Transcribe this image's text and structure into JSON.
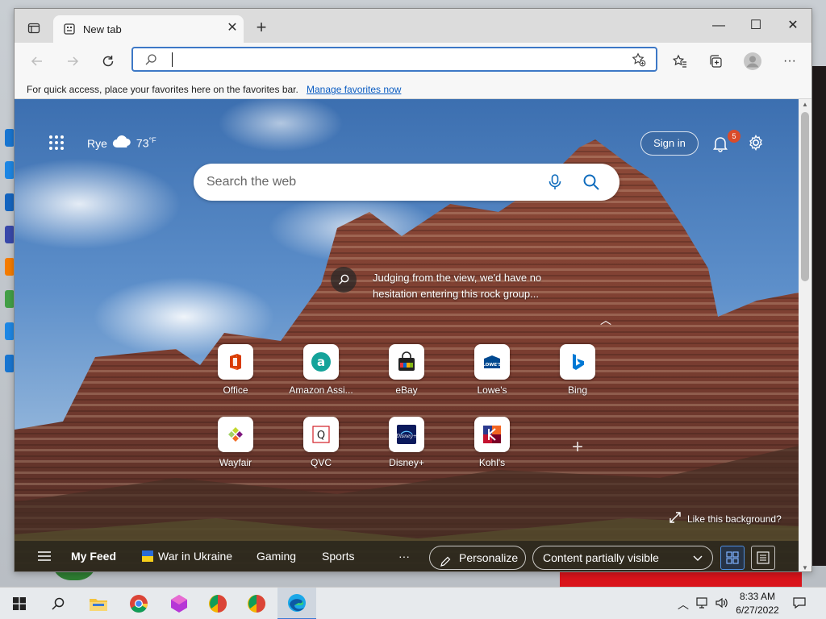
{
  "browser": {
    "tab": {
      "title": "New tab"
    },
    "address_bar": {
      "value": "",
      "placeholder": ""
    },
    "favorites_bar": {
      "message": "For quick access, place your favorites here on the favorites bar.",
      "link": "Manage favorites now"
    }
  },
  "newtab": {
    "weather": {
      "location": "Rye",
      "temp": "73",
      "unit": "°F",
      "icon": "cloud-icon"
    },
    "sign_in": "Sign in",
    "notifications_count": "5",
    "search_placeholder": "Search the web",
    "story": "Judging from the view, we'd have no hesitation entering this rock group...",
    "quick_links": [
      {
        "label": "Office",
        "icon": "office-icon",
        "color": "#d83b01"
      },
      {
        "label": "Amazon Assi...",
        "icon": "amazon-assistant-icon",
        "color": "#14a39a"
      },
      {
        "label": "eBay",
        "icon": "ebay-icon",
        "color": "#e53238"
      },
      {
        "label": "Lowe's",
        "icon": "lowes-icon",
        "color": "#004990"
      },
      {
        "label": "Bing",
        "icon": "bing-icon",
        "color": "#0078d4"
      },
      {
        "label": "Wayfair",
        "icon": "wayfair-icon",
        "color": "#7f187f"
      },
      {
        "label": "QVC",
        "icon": "qvc-icon",
        "color": "#d21f27"
      },
      {
        "label": "Disney+",
        "icon": "disney-plus-icon",
        "color": "#0b1a5c"
      },
      {
        "label": "Kohl's",
        "icon": "kohls-icon",
        "color": "#7a0026"
      }
    ],
    "like_background": "Like this background?",
    "feed": {
      "my_feed": "My Feed",
      "items": [
        "War in Ukraine",
        "Gaming",
        "Sports"
      ],
      "more": "···",
      "personalize": "Personalize",
      "content_visibility": "Content partially visible"
    }
  },
  "taskbar": {
    "time": "8:33 AM",
    "date": "6/27/2022",
    "apps": [
      "file-explorer-icon",
      "chrome-icon",
      "app-icon",
      "app-icon",
      "app-icon",
      "edge-icon"
    ]
  }
}
